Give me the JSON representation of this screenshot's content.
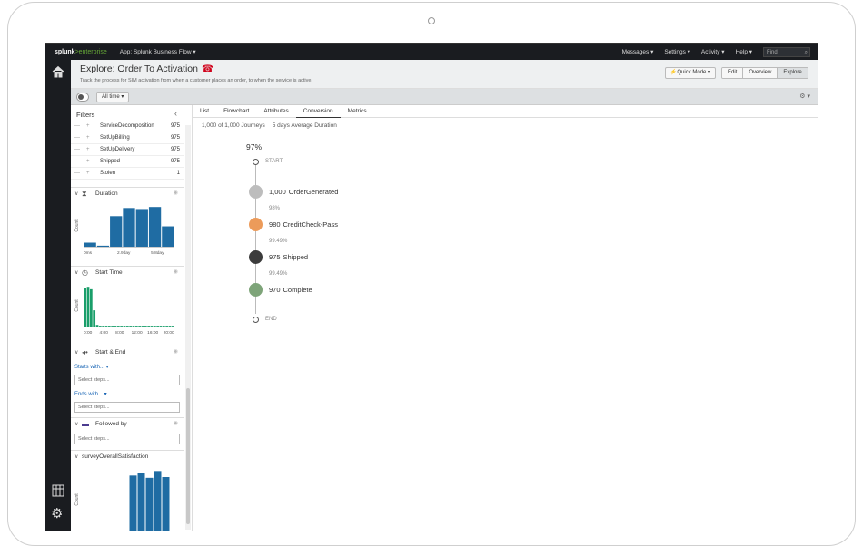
{
  "topbar": {
    "logo_prefix": "splunk",
    "logo_suffix": ">enterprise",
    "app_name": "App: Splunk Business Flow ▾",
    "nav": [
      "Messages ▾",
      "Settings ▾",
      "Activity ▾",
      "Help ▾"
    ],
    "find_placeholder": "Find"
  },
  "header": {
    "title": "Explore: Order To Activation",
    "subtitle": "Track the process for SIM activation from when a customer places an order, to when the service is active.",
    "quick_mode": "⚡Quick Mode ▾",
    "modes": [
      "Edit",
      "Overview",
      "Explore"
    ],
    "active_mode": "Explore"
  },
  "controls": {
    "time_range": "All time ▾",
    "settings": "⚙ ▾"
  },
  "filters": {
    "title": "Filters",
    "attribute_rows": [
      {
        "label": "ServiceDecomposition",
        "count": "975"
      },
      {
        "label": "SetUpBilling",
        "count": "975"
      },
      {
        "label": "SetUpDelivery",
        "count": "975"
      },
      {
        "label": "Shipped",
        "count": "975"
      },
      {
        "label": "Stolen",
        "count": "1"
      }
    ],
    "sections": {
      "duration": "Duration",
      "start_time": "Start Time",
      "start_end": "Start & End",
      "followed_by": "Followed by",
      "survey": "surveyOverallSatisfaction"
    },
    "duration_chart": {
      "ylabel": "Count",
      "ticks": [
        "0ms",
        "2.9day",
        "5.8day"
      ],
      "values": [
        4,
        1,
        30,
        38,
        37,
        39,
        20
      ]
    },
    "start_time_chart": {
      "ylabel": "Count",
      "ticks": [
        "0:00",
        "4:00",
        "8:00",
        "12:00",
        "16:00",
        "20:00"
      ],
      "values": [
        95,
        98,
        92,
        40,
        4,
        2,
        2,
        2,
        2,
        2,
        2,
        2,
        2,
        2,
        2,
        2,
        2,
        2,
        2,
        2,
        2,
        2,
        2,
        2,
        2,
        2,
        2,
        2,
        2,
        2
      ]
    },
    "survey_chart": {
      "ylabel": "Count",
      "values": [
        74,
        77,
        71,
        80,
        72
      ]
    },
    "starts_with": "Starts with... ▾",
    "ends_with": "Ends with... ▾",
    "select_placeholder": "Select steps..."
  },
  "main": {
    "tabs": [
      "List",
      "Flowchart",
      "Attributes",
      "Conversion",
      "Metrics"
    ],
    "active_tab": "Conversion",
    "journeys": "1,000 of 1,000 Journeys",
    "avg_duration": "5 days Average Duration",
    "conversion": "97%",
    "start_label": "START",
    "end_label": "END",
    "steps": [
      {
        "count": "1,000",
        "name": "OrderGenerated",
        "color": "#bdbdbd"
      },
      {
        "count": "980",
        "name": "CreditCheck-Pass",
        "color": "#ec9b5a"
      },
      {
        "count": "975",
        "name": "Shipped",
        "color": "#3c3c3c"
      },
      {
        "count": "970",
        "name": "Complete",
        "color": "#7ea479"
      }
    ],
    "step_rates": [
      "98%",
      "99.49%",
      "99.49%"
    ]
  }
}
